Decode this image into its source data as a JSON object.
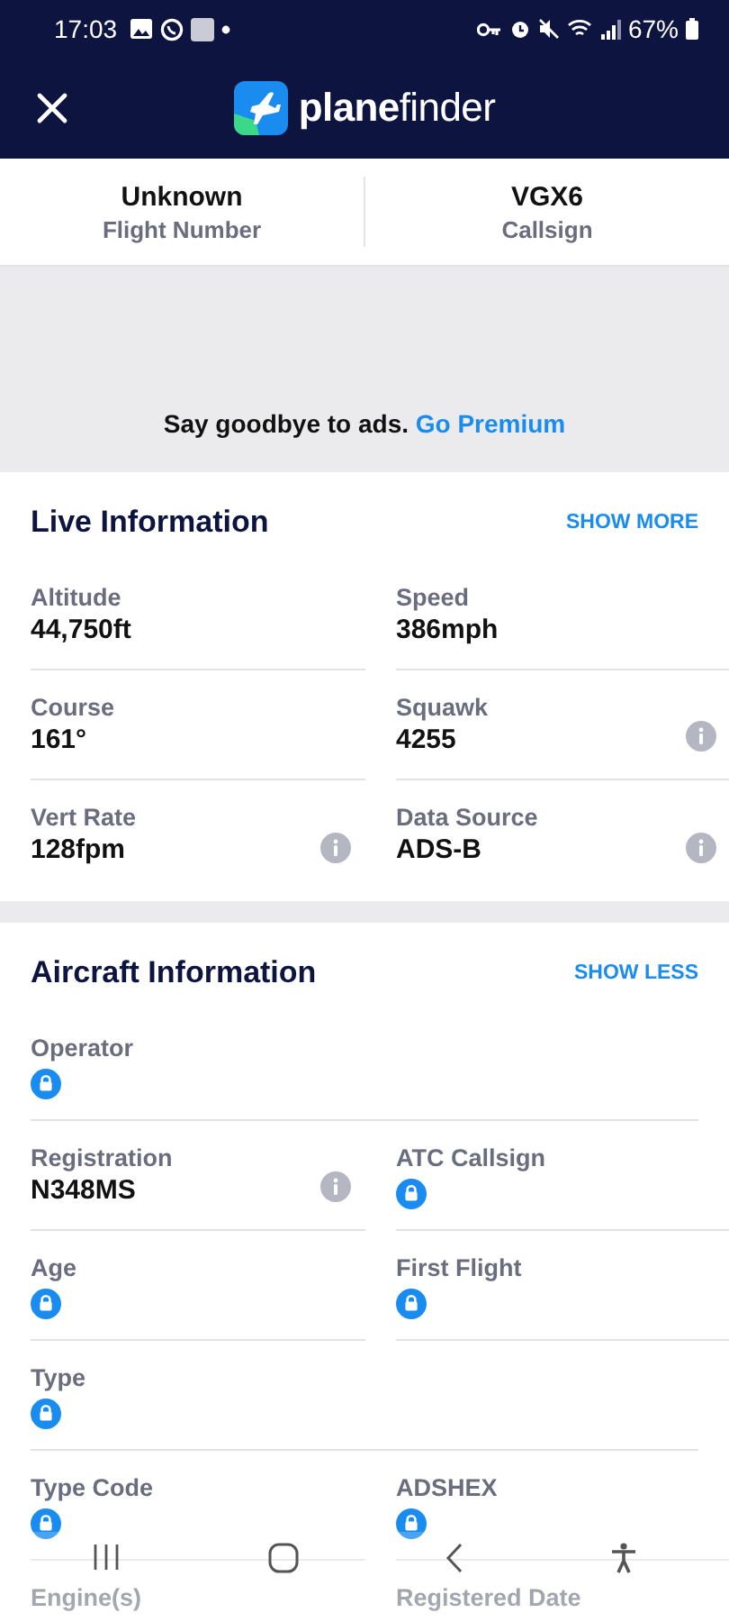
{
  "status_bar": {
    "time": "17:03",
    "battery": "67%"
  },
  "header": {
    "logo_text": "**plane**finder"
  },
  "summary": [
    {
      "value": "Unknown",
      "label": "Flight Number"
    },
    {
      "value": "VGX6",
      "label": "Callsign"
    }
  ],
  "ad": {
    "text": "Say goodbye to ads.",
    "link": "Go Premium"
  },
  "sections": [
    {
      "title": "Live Information",
      "toggle": "SHOW MORE",
      "rows": [
        [
          {
            "label": "Altitude",
            "value": "44,750ft",
            "locked": false,
            "info": false
          },
          {
            "label": "Speed",
            "value": "386mph",
            "locked": false,
            "info": false
          }
        ],
        [
          {
            "label": "Course",
            "value": "161°",
            "locked": false,
            "info": false
          },
          {
            "label": "Squawk",
            "value": "4255",
            "locked": false,
            "info": true
          }
        ],
        [
          {
            "label": "Vert Rate",
            "value": "128fpm",
            "locked": false,
            "info": true
          },
          {
            "label": "Data Source",
            "value": "ADS-B",
            "locked": false,
            "info": true
          }
        ]
      ]
    },
    {
      "title": "Aircraft Information",
      "toggle": "SHOW LESS",
      "rows": [
        [
          {
            "label": "Operator",
            "locked": true,
            "info": false
          }
        ],
        [
          {
            "label": "Registration",
            "value": "N348MS",
            "locked": false,
            "info": true
          },
          {
            "label": "ATC Callsign",
            "locked": true,
            "info": false
          }
        ],
        [
          {
            "label": "Age",
            "locked": true,
            "info": false
          },
          {
            "label": "First Flight",
            "locked": true,
            "info": false
          }
        ],
        [
          {
            "label": "Type",
            "locked": true,
            "info": false
          }
        ],
        [
          {
            "label": "Type Code",
            "locked": true,
            "info": false
          },
          {
            "label": "ADSHEX",
            "locked": true,
            "info": false
          }
        ],
        [
          {
            "label": "Engine(s)",
            "locked": false,
            "info": false
          },
          {
            "label": "Registered Date",
            "locked": false,
            "info": false
          }
        ]
      ]
    }
  ]
}
